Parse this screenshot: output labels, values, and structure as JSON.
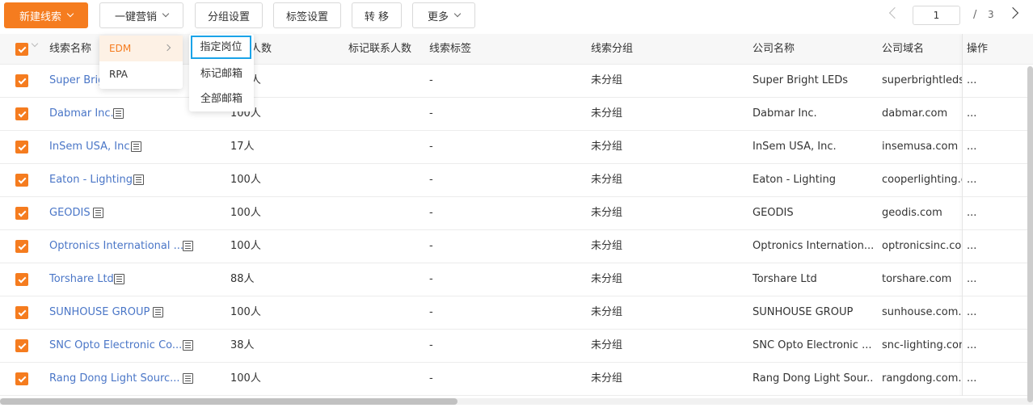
{
  "toolbar": {
    "new_lead": "新建线索",
    "one_click_marketing": "一键营销",
    "group_settings": "分组设置",
    "tag_settings": "标签设置",
    "transfer": "转 移",
    "more": "更多",
    "accent_color": "#f57c1f"
  },
  "pager": {
    "current_page": "1",
    "separator": "/",
    "total_pages": "3"
  },
  "marketing_menu": {
    "items": [
      {
        "label": "EDM"
      },
      {
        "label": "RPA"
      }
    ]
  },
  "edm_submenu": {
    "items": [
      {
        "label": "指定岗位"
      },
      {
        "label": "标记邮箱"
      },
      {
        "label": "全部邮箱"
      }
    ]
  },
  "table": {
    "columns": {
      "lead_name": "线索名称",
      "people_count": "人数",
      "marked_contacts": "标记联系人数",
      "lead_tags": "线索标签",
      "lead_group": "线索分组",
      "company_name": "公司名称",
      "company_domain": "公司域名",
      "actions": "操作"
    },
    "rows": [
      {
        "name": "Super Bright LEDs",
        "people": "100人",
        "tags": "-",
        "group": "未分组",
        "company": "Super Bright LEDs",
        "domain": "superbrightleds.com",
        "actions": "..."
      },
      {
        "name": "Dabmar Inc.",
        "people": "100人",
        "tags": "-",
        "group": "未分组",
        "company": "Dabmar Inc.",
        "domain": "dabmar.com",
        "actions": "..."
      },
      {
        "name": "InSem USA, Inc.",
        "people": "17人",
        "tags": "-",
        "group": "未分组",
        "company": "InSem USA, Inc.",
        "domain": "insemusa.com",
        "actions": "..."
      },
      {
        "name": "Eaton - Lighting",
        "people": "100人",
        "tags": "-",
        "group": "未分组",
        "company": "Eaton - Lighting",
        "domain": "cooperlighting.com",
        "actions": "..."
      },
      {
        "name": "GEODIS",
        "people": "100人",
        "tags": "-",
        "group": "未分组",
        "company": "GEODIS",
        "domain": "geodis.com",
        "actions": "..."
      },
      {
        "name": "Optronics International ...",
        "people": "100人",
        "tags": "-",
        "group": "未分组",
        "company": "Optronics Internation...",
        "domain": "optronicsinc.com",
        "actions": "..."
      },
      {
        "name": "Torshare Ltd",
        "people": "88人",
        "tags": "-",
        "group": "未分组",
        "company": "Torshare Ltd",
        "domain": "torshare.com",
        "actions": "..."
      },
      {
        "name": "SUNHOUSE GROUP",
        "people": "100人",
        "tags": "-",
        "group": "未分组",
        "company": "SUNHOUSE GROUP",
        "domain": "sunhouse.com.vn",
        "actions": "..."
      },
      {
        "name": "SNC Opto Electronic Co...",
        "people": "38人",
        "tags": "-",
        "group": "未分组",
        "company": "SNC Opto Electronic ...",
        "domain": "snc-lighting.com",
        "actions": "..."
      },
      {
        "name": "Rang Dong Light Sourc...",
        "people": "100人",
        "tags": "-",
        "group": "未分组",
        "company": "Rang Dong Light Sour...",
        "domain": "rangdong.com.vn",
        "actions": "..."
      }
    ]
  }
}
